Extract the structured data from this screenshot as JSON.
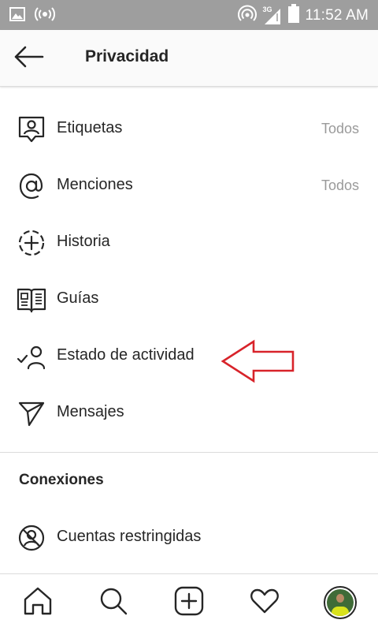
{
  "status_bar": {
    "time": "11:52 AM",
    "network_type": "3G",
    "icons": [
      "image-icon",
      "broadcast-icon",
      "hotspot-icon",
      "signal-icon",
      "battery-icon"
    ]
  },
  "app_bar": {
    "title": "Privacidad",
    "back_icon": "arrow-left-icon"
  },
  "settings": [
    {
      "label": "Etiquetas",
      "value": "Todos",
      "icon": "tag-person-icon"
    },
    {
      "label": "Menciones",
      "value": "Todos",
      "icon": "at-sign-icon"
    },
    {
      "label": "Historia",
      "value": "",
      "icon": "story-add-icon"
    },
    {
      "label": "Guías",
      "value": "",
      "icon": "guide-book-icon"
    },
    {
      "label": "Estado de actividad",
      "value": "",
      "icon": "activity-status-icon"
    },
    {
      "label": "Mensajes",
      "value": "",
      "icon": "paper-plane-icon"
    }
  ],
  "connections": {
    "title": "Conexiones",
    "items": [
      {
        "label": "Cuentas restringidas",
        "value": "",
        "icon": "restricted-icon"
      }
    ]
  },
  "annotation": {
    "type": "arrow",
    "color": "#d8232a"
  },
  "bottom_nav": [
    "home-icon",
    "search-icon",
    "new-post-icon",
    "activity-heart-icon",
    "profile-avatar"
  ],
  "colors": {
    "status_bar_bg": "#9e9e9e",
    "text": "#262626",
    "secondary_text": "#9a9a9a",
    "annotation_arrow": "#d8232a"
  }
}
